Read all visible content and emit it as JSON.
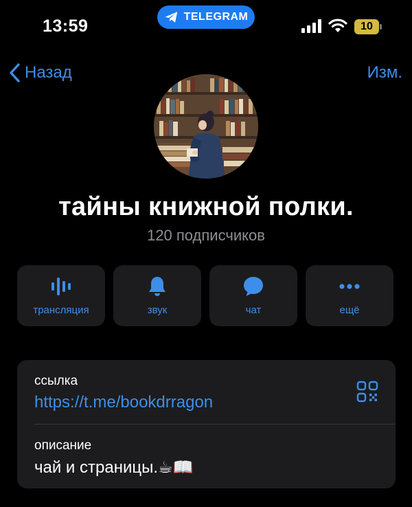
{
  "status_bar": {
    "time": "13:59",
    "app_pill_label": "TELEGRAM",
    "battery_level": "10",
    "signal_icon": "signal-bars-icon",
    "wifi_icon": "wifi-icon"
  },
  "nav": {
    "back_label": "Назад",
    "edit_label": "Изм."
  },
  "profile": {
    "title": "тайны книжной полки.",
    "subscribers": "120 подписчиков"
  },
  "actions": [
    {
      "label": "трансляция",
      "icon": "live-stream-icon"
    },
    {
      "label": "звук",
      "icon": "bell-icon"
    },
    {
      "label": "чат",
      "icon": "chat-bubble-icon"
    },
    {
      "label": "ещё",
      "icon": "more-dots-icon"
    }
  ],
  "info": {
    "link_caption": "ссылка",
    "link_value": "https://t.me/bookdrragon",
    "description_caption": "описание",
    "description_value": "чай и страницы.☕📖"
  },
  "colors": {
    "accent": "#3d8ee8",
    "telegram_pill": "#1e7cf2",
    "card_bg": "#1c1c1e",
    "secondary_text": "#8e8e93",
    "battery": "#d4ba3f"
  }
}
